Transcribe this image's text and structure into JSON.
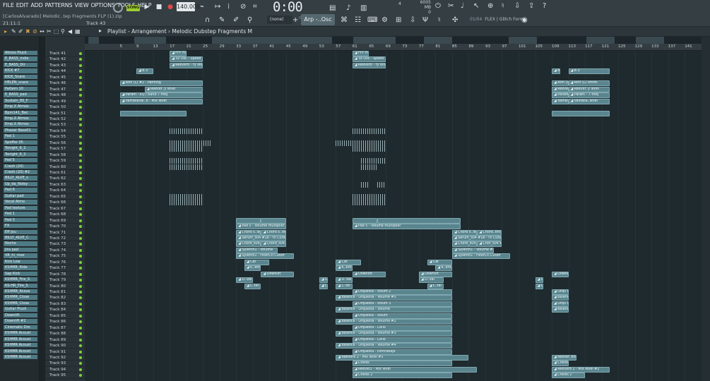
{
  "menu": [
    "FILE",
    "EDIT",
    "ADD",
    "PATTERNS",
    "VIEW",
    "OPTIONS",
    "TOOLS",
    "HELP"
  ],
  "file_title": "[CarlosAlvarado] Melodic..tep Fragments FLP (1).zip",
  "position_readout": "21:11:1",
  "hint_track": "Track 43",
  "song_badge": "SONG",
  "tempo": "140.000",
  "time": "0:00",
  "time_sub": "00",
  "mem": "6005 MB",
  "mem2": "0",
  "cpu": "4",
  "pattern_none": "(none)",
  "arp_select": "Arp -..Osc #8",
  "hint_bar": "01/04",
  "hint_text": "FLEX | Glitch Form",
  "playlist_title": "Playlist - Arrangement",
  "playlist_sub": "Melodic Dubstep Fragments M",
  "ruler_ticks": [
    5,
    9,
    13,
    17,
    21,
    25,
    29,
    33,
    37,
    41,
    45,
    49,
    53,
    57,
    61,
    65,
    69,
    73,
    77,
    81,
    85,
    89,
    93,
    97,
    101,
    105,
    109,
    113,
    117,
    121,
    125,
    129,
    133,
    137,
    141,
    145,
    149,
    153
  ],
  "channels": [
    "Atmos Pluck",
    "E_BASS_indie",
    "E_BASS_Dir",
    "KICK #7",
    "KICK_Snare",
    "HELEN_snare",
    "Pattern 10",
    "E_BASS_pad",
    "Sustain_85_F",
    "Emp.X Atmos",
    "Bpm141_Bec",
    "Emp.X Atmos",
    "Emp.X Atmos",
    "Phaser Bass01",
    "Pad 1",
    "Spoffer 05",
    "Tonight_6_2",
    "Tonight_6_2",
    "Pad 5",
    "Crash (20)",
    "Crash (20) #2",
    "BILLY_ALVE_s",
    "Up_da_Noley",
    "Pad 6",
    "Guitar pad",
    "Vocal Atmo",
    "Pad texture",
    "Pad 1",
    "Pad 3",
    "FX",
    "Eff Jou",
    "BILLY_ALVE_C",
    "Noche",
    "Jira pad",
    "VR_hi_river",
    "Kick Low",
    "KSHMR_Ride",
    "Sap Kick",
    "KSHMR_Fire_S",
    "KS-HR_Fire_S",
    "KSHMR_Acous",
    "KSHMR_Close",
    "KSHMR_Close",
    "Guitar Pluck",
    "Downlift",
    "Downlift #2",
    "Cinematic Dro",
    "KSHMR Acoust",
    "KSHMR Acoust",
    "KSHMR Acoust",
    "KSHMR Acoust",
    "KSHMR Acoust"
  ],
  "tracks": [
    "Track 41",
    "Track 42",
    "Track 43",
    "Track 44",
    "Track 45",
    "Track 46",
    "Track 47",
    "Track 48",
    "Track 49",
    "Track 50",
    "Track 51",
    "Track 52",
    "Track 53",
    "Track 54",
    "Track 55",
    "Track 56",
    "Track 57",
    "Track 58",
    "Track 59",
    "Track 60",
    "Track 61",
    "Track 62",
    "Track 63",
    "Track 64",
    "Track 65",
    "Track 66",
    "Track 67",
    "Track 68",
    "Track 69",
    "Track 70",
    "Track 71",
    "Track 72",
    "Track 73",
    "Track 74",
    "Track 75",
    "Track 76",
    "Track 77",
    "Track 78",
    "Track 79",
    "Track 80",
    "Track 81",
    "Track 82",
    "Track 83",
    "Track 84",
    "Track 85",
    "Track 86",
    "Track 87",
    "Track 88",
    "Track 89",
    "Track 90",
    "Track 91",
    "Track 92",
    "Track 93",
    "Track 94",
    "Track 95"
  ],
  "clips": [
    {
      "t": 0,
      "s": 17,
      "e": 21,
      "l": "FFF H5"
    },
    {
      "t": 0,
      "s": 61,
      "e": 65,
      "l": "FFF H5"
    },
    {
      "t": 1,
      "s": 17,
      "e": 25,
      "l": "3x Osc - Speed"
    },
    {
      "t": 1,
      "s": 61,
      "e": 69,
      "l": "3x Osc - Speed"
    },
    {
      "t": 2,
      "s": 17,
      "e": 25,
      "l": "Reeverb - ry level"
    },
    {
      "t": 2,
      "s": 61,
      "e": 69,
      "l": "Reeverb - ry level"
    },
    {
      "t": 3,
      "s": 9,
      "e": 13,
      "l": "B 3"
    },
    {
      "t": 3,
      "s": 109,
      "e": 111,
      "l": "B 3"
    },
    {
      "t": 3,
      "s": 113,
      "e": 123,
      "l": "B 3"
    },
    {
      "t": 5,
      "s": 5,
      "e": 25,
      "l": "Atm (L) #2 - Panning"
    },
    {
      "t": 5,
      "s": 109,
      "e": 113,
      "l": "Atm (L) ommi"
    },
    {
      "t": 5,
      "s": 113,
      "e": 123,
      "l": "Atm (L) ommi"
    },
    {
      "t": 6,
      "s": 11,
      "e": 25,
      "l": "Reever..y level"
    },
    {
      "t": 6,
      "s": 109,
      "e": 113,
      "l": "Reever..y level"
    },
    {
      "t": 6,
      "s": 113,
      "e": 123,
      "l": "Reever..y level"
    },
    {
      "t": 7,
      "s": 5,
      "e": 25,
      "l": "Param - EQ / Band 7 freq"
    },
    {
      "t": 7,
      "s": 109,
      "e": 113,
      "l": "Param - 7 freq"
    },
    {
      "t": 7,
      "s": 113,
      "e": 123,
      "l": "Param - 7 freq"
    },
    {
      "t": 8,
      "s": 5,
      "e": 25,
      "l": "Valhallaval..b - Mix level"
    },
    {
      "t": 8,
      "s": 109,
      "e": 113,
      "l": "Valhall..a level"
    },
    {
      "t": 8,
      "s": 113,
      "e": 123,
      "l": "Valhalla..level"
    },
    {
      "t": 10,
      "s": 5,
      "e": 21,
      "l": ""
    },
    {
      "t": 10,
      "s": 109,
      "e": 123,
      "l": ""
    },
    {
      "t": 28,
      "s": 33,
      "e": 39,
      "l": ""
    },
    {
      "t": 28,
      "s": 39,
      "e": 45,
      "l": ""
    },
    {
      "t": 28,
      "s": 61,
      "e": 67,
      "l": ""
    },
    {
      "t": 28,
      "s": 67,
      "e": 87,
      "l": ""
    },
    {
      "t": 29,
      "s": 33,
      "e": 45,
      "l": "Pad 5 - Volume multiplier"
    },
    {
      "t": 29,
      "s": 61,
      "e": 87,
      "l": "Pad 5 - Volume multiplier"
    },
    {
      "t": 30,
      "s": 33,
      "e": 39,
      "l": "Chord s..lenth"
    },
    {
      "t": 30,
      "s": 39,
      "e": 45,
      "l": "Chord s..lenth"
    },
    {
      "t": 30,
      "s": 85,
      "e": 91,
      "l": "Chord s..lenth"
    },
    {
      "t": 30,
      "s": 91,
      "e": 97,
      "l": "Chord..enth"
    },
    {
      "t": 31,
      "s": 33,
      "e": 45,
      "l": "Serum_s04 #1b - Fil Cutoff"
    },
    {
      "t": 31,
      "s": 85,
      "e": 97,
      "l": "Serum_s04 #1b - Fil Cutoff"
    },
    {
      "t": 32,
      "s": 33,
      "e": 39,
      "l": "Chord_s04 #1b"
    },
    {
      "t": 32,
      "s": 39,
      "e": 45,
      "l": "Chord_s04 #1b"
    },
    {
      "t": 32,
      "s": 85,
      "e": 91,
      "l": "Chord_s04 #1b"
    },
    {
      "t": 32,
      "s": 91,
      "e": 97,
      "l": "Chor_s04 #1b"
    },
    {
      "t": 33,
      "s": 33,
      "e": 43,
      "l": "Sylenth1 - Volume"
    },
    {
      "t": 33,
      "s": 85,
      "e": 95,
      "l": "Sylenth1 - Volume #2"
    },
    {
      "t": 34,
      "s": 33,
      "e": 47,
      "l": "Sylenth1 - FilterCtl Cutoff"
    },
    {
      "t": 34,
      "s": 85,
      "e": 99,
      "l": "Sylenth1 - FilterCtl Cutoff"
    },
    {
      "t": 35,
      "s": 35,
      "e": 41,
      "l": "Cat"
    },
    {
      "t": 35,
      "s": 57,
      "e": 63,
      "l": "Cat"
    },
    {
      "t": 35,
      "s": 79,
      "e": 85,
      "l": "Cat"
    },
    {
      "t": 36,
      "s": 35,
      "e": 39,
      "l": "K..ent"
    },
    {
      "t": 36,
      "s": 57,
      "e": 61,
      "l": "K..ent"
    },
    {
      "t": 36,
      "s": 81,
      "e": 85,
      "l": "K..ent"
    },
    {
      "t": 37,
      "s": 39,
      "e": 47,
      "l": "Downlift"
    },
    {
      "t": 37,
      "s": 61,
      "e": 69,
      "l": "Downlift"
    },
    {
      "t": 37,
      "s": 77,
      "e": 85,
      "l": "Downlift"
    },
    {
      "t": 37,
      "s": 109,
      "e": 113,
      "l": "Downlift"
    },
    {
      "t": 38,
      "s": 33,
      "e": 37,
      "l": "D..val"
    },
    {
      "t": 38,
      "s": 53,
      "e": 55,
      "l": "D..val"
    },
    {
      "t": 38,
      "s": 57,
      "e": 61,
      "l": "D..val"
    },
    {
      "t": 38,
      "s": 77,
      "e": 83,
      "l": "D..val"
    },
    {
      "t": 38,
      "s": 105,
      "e": 107,
      "l": "D..val"
    },
    {
      "t": 39,
      "s": 35,
      "e": 39,
      "l": "L..tel"
    },
    {
      "t": 39,
      "s": 53,
      "e": 55,
      "l": "L..tel"
    },
    {
      "t": 39,
      "s": 57,
      "e": 61,
      "l": "L..tel"
    },
    {
      "t": 39,
      "s": 79,
      "e": 83,
      "l": "L..tel"
    },
    {
      "t": 39,
      "s": 105,
      "e": 107,
      "l": "L..tel"
    },
    {
      "t": 40,
      "s": 61,
      "e": 85,
      "l": "Orquesta - Volum 2"
    },
    {
      "t": 40,
      "s": 109,
      "e": 113,
      "l": "Orqu #2"
    },
    {
      "t": 41,
      "s": 57,
      "e": 85,
      "l": "Balance - Orquesta - Volume #5"
    },
    {
      "t": 41,
      "s": 109,
      "e": 113,
      "l": "Balance - ume #2"
    },
    {
      "t": 42,
      "s": 61,
      "e": 85,
      "l": "Orquesta - Volum 3"
    },
    {
      "t": 42,
      "s": 109,
      "e": 113,
      "l": "Orqu #3"
    },
    {
      "t": 43,
      "s": 57,
      "e": 85,
      "l": "Balance - Orquesta - Volume"
    },
    {
      "t": 43,
      "s": 109,
      "e": 113,
      "l": "Balanc - Volume"
    },
    {
      "t": 44,
      "s": 61,
      "e": 85,
      "l": "Orquesta - Volum"
    },
    {
      "t": 45,
      "s": 57,
      "e": 85,
      "l": "Balance - Orquesta - Volume #2"
    },
    {
      "t": 46,
      "s": 61,
      "e": 85,
      "l": "Orquesta - Cello"
    },
    {
      "t": 47,
      "s": 57,
      "e": 85,
      "l": "Balance - Orquesta - Volume #3"
    },
    {
      "t": 48,
      "s": 61,
      "e": 85,
      "l": "Orquesta - Cello"
    },
    {
      "t": 49,
      "s": 57,
      "e": 85,
      "l": "Balance - Orquesta - Volume #4"
    },
    {
      "t": 50,
      "s": 61,
      "e": 85,
      "l": "Orquesta - contrabajo"
    },
    {
      "t": 51,
      "s": 57,
      "e": 89,
      "l": "Reeverb 2 - Mix level #5"
    },
    {
      "t": 51,
      "s": 109,
      "e": 115,
      "l": "Reever..evel #5"
    },
    {
      "t": 52,
      "s": 61,
      "e": 85,
      "l": "Cheiss"
    },
    {
      "t": 52,
      "s": 109,
      "e": 113,
      "l": "Cheiss"
    },
    {
      "t": 53,
      "s": 61,
      "e": 91,
      "l": "Reever2 - Mix level"
    },
    {
      "t": 53,
      "s": 109,
      "e": 123,
      "l": "Reeverb 2 - Mix level #2"
    },
    {
      "t": 54,
      "s": 61,
      "e": 85,
      "l": "Cheiss 2"
    },
    {
      "t": 54,
      "s": 109,
      "e": 117,
      "l": "Cheiss 2"
    }
  ],
  "bars": [
    {
      "t": 13,
      "s": 17,
      "e": 25
    },
    {
      "t": 13,
      "s": 61,
      "e": 69
    },
    {
      "t": 15,
      "s": 17,
      "e": 27
    },
    {
      "t": 15,
      "s": 57,
      "e": 69
    },
    {
      "t": 16,
      "s": 17,
      "e": 25
    },
    {
      "t": 16,
      "s": 61,
      "e": 69
    },
    {
      "t": 18,
      "s": 17,
      "e": 25
    },
    {
      "t": 18,
      "s": 63,
      "e": 69
    },
    {
      "t": 19,
      "s": 17,
      "e": 25
    },
    {
      "t": 19,
      "s": 63,
      "e": 67
    },
    {
      "t": 22,
      "s": 63,
      "e": 65
    },
    {
      "t": 22,
      "s": 67,
      "e": 69
    },
    {
      "t": 24,
      "s": 17,
      "e": 25
    },
    {
      "t": 24,
      "s": 61,
      "e": 69
    },
    {
      "t": 25,
      "s": 17,
      "e": 25
    },
    {
      "t": 25,
      "s": 61,
      "e": 69
    }
  ]
}
